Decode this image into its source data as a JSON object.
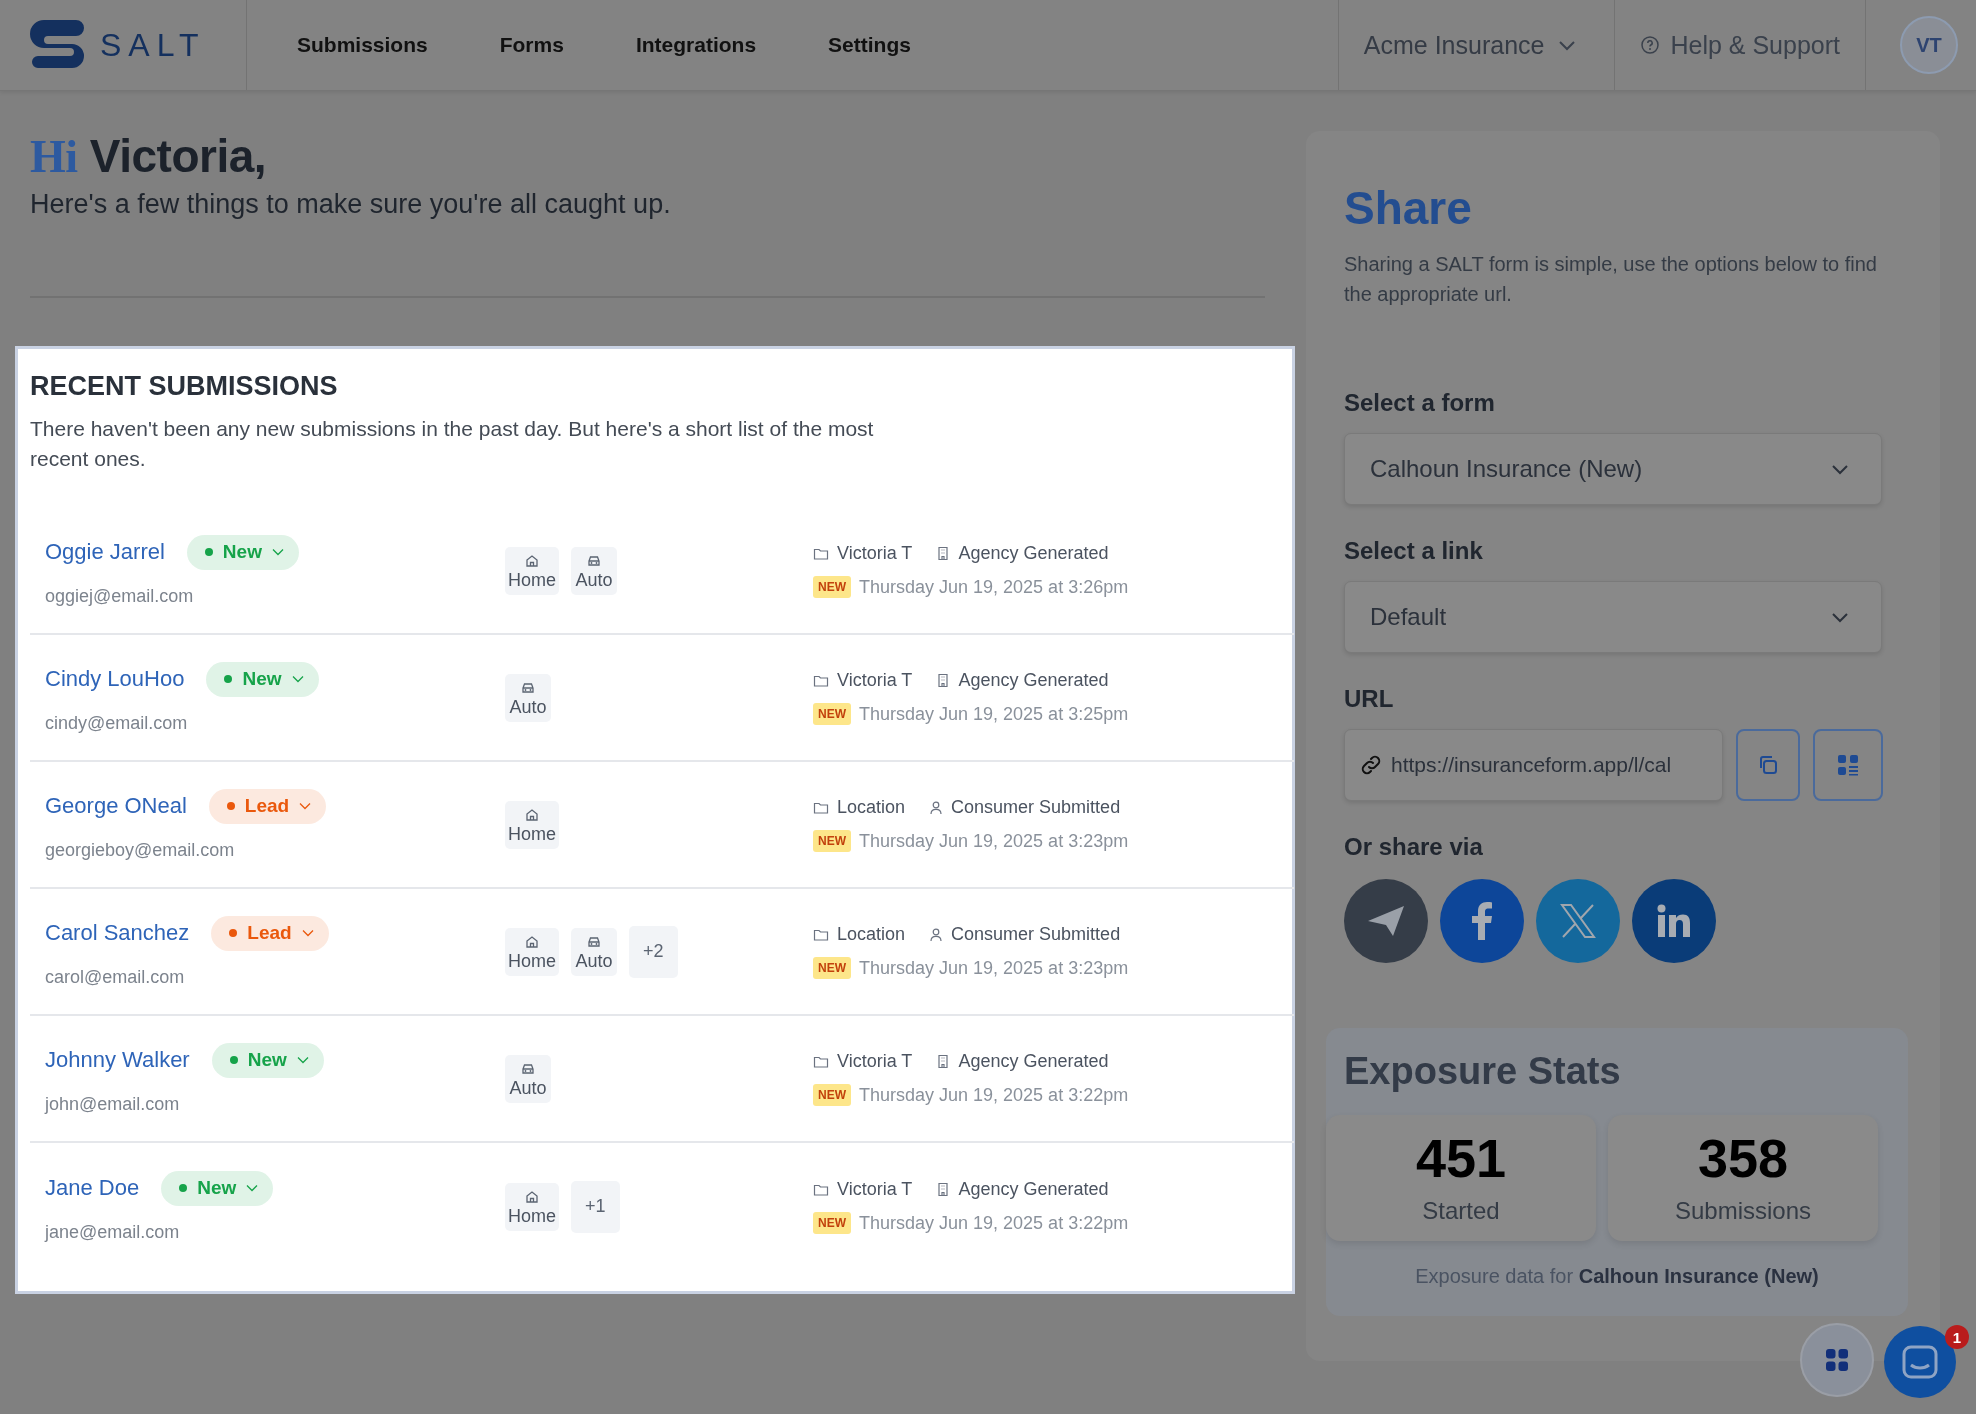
{
  "header": {
    "logo_text": "SALT",
    "nav": [
      {
        "label": "Submissions"
      },
      {
        "label": "Forms"
      },
      {
        "label": "Integrations"
      },
      {
        "label": "Settings"
      }
    ],
    "account": "Acme Insurance",
    "help": "Help & Support",
    "avatar": "VT"
  },
  "greeting": {
    "hi": "Hi",
    "name": "Victoria,",
    "subtitle": "Here's a few things to make sure you're all caught up."
  },
  "recent": {
    "title": "RECENT SUBMISSIONS",
    "description": "There haven't been any new submissions in the past day. But here's a short list of the most recent ones.",
    "rows": [
      {
        "name": "Oggie Jarrel",
        "email": "oggiej@email.com",
        "status": "New",
        "color": "#16a34a",
        "tags": [
          {
            "kind": "home",
            "label": "Home"
          },
          {
            "kind": "auto",
            "label": "Auto"
          }
        ],
        "owner": "Victoria T",
        "kind": "agency",
        "source": "Agency Generated",
        "badge": "NEW",
        "date": "Thursday Jun 19, 2025 at 3:26pm"
      },
      {
        "name": "Cindy LouHoo",
        "email": "cindy@email.com",
        "status": "New",
        "color": "#16a34a",
        "tags": [
          {
            "kind": "auto",
            "label": "Auto"
          }
        ],
        "owner": "Victoria T",
        "kind": "agency",
        "source": "Agency Generated",
        "badge": "NEW",
        "date": "Thursday Jun 19, 2025 at 3:25pm"
      },
      {
        "name": "George ONeal",
        "email": "georgieboy@email.com",
        "status": "Lead",
        "color": "#ea580c",
        "tags": [
          {
            "kind": "home",
            "label": "Home"
          }
        ],
        "owner": "Location",
        "kind": "consumer",
        "source": "Consumer Submitted",
        "badge": "NEW",
        "date": "Thursday Jun 19, 2025 at 3:23pm"
      },
      {
        "name": "Carol Sanchez",
        "email": "carol@email.com",
        "status": "Lead",
        "color": "#ea580c",
        "tags": [
          {
            "kind": "home",
            "label": "Home"
          },
          {
            "kind": "auto",
            "label": "Auto"
          },
          {
            "kind": "more",
            "label": "+2"
          }
        ],
        "owner": "Location",
        "kind": "consumer",
        "source": "Consumer Submitted",
        "badge": "NEW",
        "date": "Thursday Jun 19, 2025 at 3:23pm"
      },
      {
        "name": "Johnny Walker",
        "email": "john@email.com",
        "status": "New",
        "color": "#16a34a",
        "tags": [
          {
            "kind": "auto",
            "label": "Auto"
          }
        ],
        "owner": "Victoria T",
        "kind": "agency",
        "source": "Agency Generated",
        "badge": "NEW",
        "date": "Thursday Jun 19, 2025 at 3:22pm"
      },
      {
        "name": "Jane Doe",
        "email": "jane@email.com",
        "status": "New",
        "color": "#16a34a",
        "tags": [
          {
            "kind": "home",
            "label": "Home"
          },
          {
            "kind": "more",
            "label": "+1"
          }
        ],
        "owner": "Victoria T",
        "kind": "agency",
        "source": "Agency Generated",
        "badge": "NEW",
        "date": "Thursday Jun 19, 2025 at 3:22pm"
      }
    ]
  },
  "share": {
    "title": "Share",
    "description": "Sharing a SALT form is simple, use the options below to find the appropriate url.",
    "form_label": "Select a form",
    "form_value": "Calhoun Insurance (New)",
    "link_label": "Select a link",
    "link_value": "Default",
    "url_label": "URL",
    "url_value": "https://insuranceform.app/l/cal",
    "share_via": "Or share via",
    "socials": [
      {
        "kind": "telegram",
        "color": "#353d48"
      },
      {
        "kind": "facebook",
        "color": "#0d4699"
      },
      {
        "kind": "x",
        "color": "#14689c"
      },
      {
        "kind": "linkedin",
        "color": "#0a3c78"
      }
    ]
  },
  "exposure": {
    "title": "Exposure Stats",
    "stats": [
      {
        "value": "451",
        "label": "Started"
      },
      {
        "value": "358",
        "label": "Submissions"
      }
    ],
    "footnote": "Exposure data for **Calhoun Insurance (New)**"
  },
  "chat": {
    "badge": "1"
  }
}
